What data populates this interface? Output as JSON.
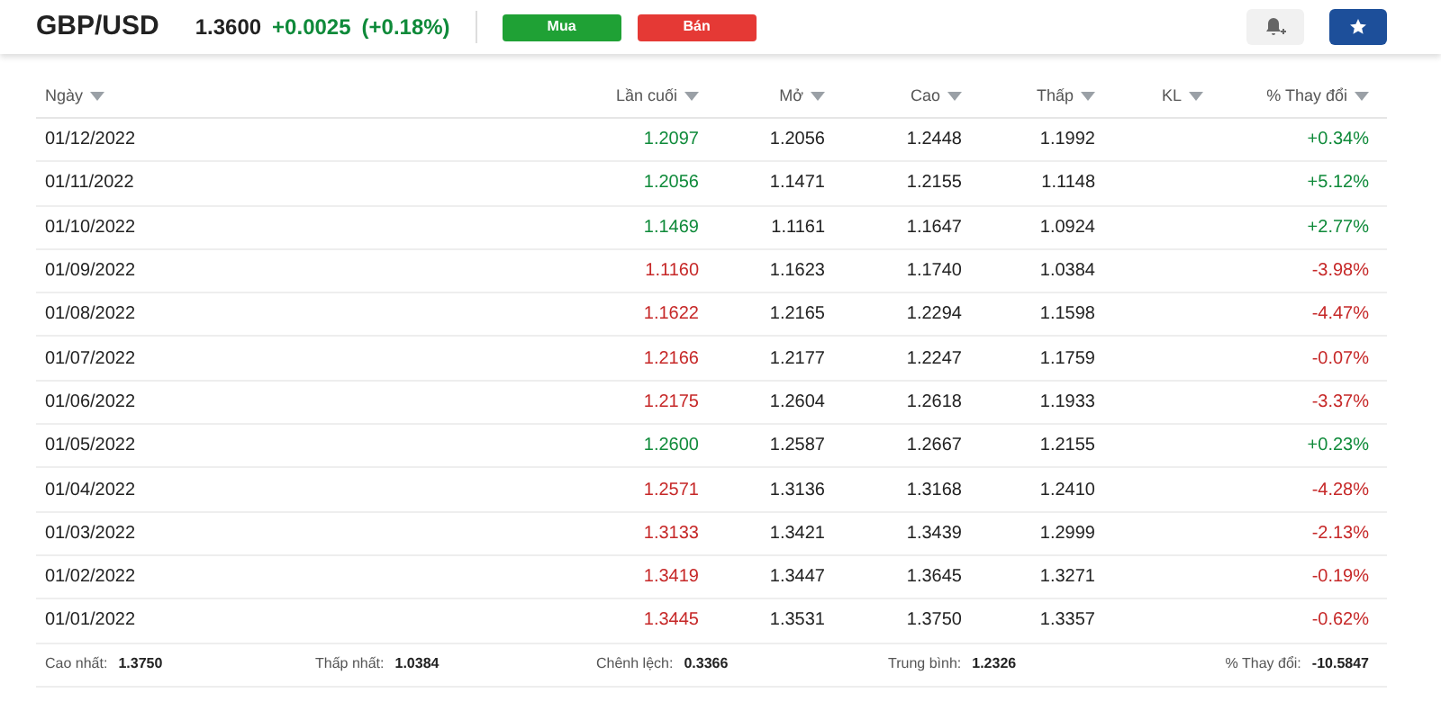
{
  "quote": {
    "symbol": "GBP/USD",
    "price": "1.3600",
    "change": "+0.0025",
    "change_pct": "(+0.18%)"
  },
  "actions": [
    {
      "label": "Mua",
      "kind": "buy"
    },
    {
      "label": "Bán",
      "kind": "sell"
    }
  ],
  "table": {
    "columns": [
      "Ngày",
      "Lần cuối",
      "Mở",
      "Cao",
      "Thấp",
      "KL",
      "% Thay đổi"
    ],
    "rows": [
      {
        "date": "01/12/2022",
        "last": "1.2097",
        "open": "1.2056",
        "high": "1.2448",
        "low": "1.1992",
        "change": "+0.34%",
        "kind": "up"
      },
      {
        "date": "01/11/2022",
        "last": "1.2056",
        "open": "1.1471",
        "high": "1.2155",
        "low": "1.1148",
        "change": "+5.12%",
        "kind": "up"
      },
      {
        "date": "01/10/2022",
        "last": "1.1469",
        "open": "1.1161",
        "high": "1.1647",
        "low": "1.0924",
        "change": "+2.77%",
        "kind": "up"
      },
      {
        "date": "01/09/2022",
        "last": "1.1160",
        "open": "1.1623",
        "high": "1.1740",
        "low": "1.0384",
        "change": "-3.98%",
        "kind": "down"
      },
      {
        "date": "01/08/2022",
        "last": "1.1622",
        "open": "1.2165",
        "high": "1.2294",
        "low": "1.1598",
        "change": "-4.47%",
        "kind": "down"
      },
      {
        "date": "01/07/2022",
        "last": "1.2166",
        "open": "1.2177",
        "high": "1.2247",
        "low": "1.1759",
        "change": "-0.07%",
        "kind": "down"
      },
      {
        "date": "01/06/2022",
        "last": "1.2175",
        "open": "1.2604",
        "high": "1.2618",
        "low": "1.1933",
        "change": "-3.37%",
        "kind": "down"
      },
      {
        "date": "01/05/2022",
        "last": "1.2600",
        "open": "1.2587",
        "high": "1.2667",
        "low": "1.2155",
        "change": "+0.23%",
        "kind": "up"
      },
      {
        "date": "01/04/2022",
        "last": "1.2571",
        "open": "1.3136",
        "high": "1.3168",
        "low": "1.2410",
        "change": "-4.28%",
        "kind": "down"
      },
      {
        "date": "01/03/2022",
        "last": "1.3133",
        "open": "1.3421",
        "high": "1.3439",
        "low": "1.2999",
        "change": "-2.13%",
        "kind": "down"
      },
      {
        "date": "01/02/2022",
        "last": "1.3419",
        "open": "1.3447",
        "high": "1.3645",
        "low": "1.3271",
        "change": "-0.19%",
        "kind": "down"
      },
      {
        "date": "01/01/2022",
        "last": "1.3445",
        "open": "1.3531",
        "high": "1.3750",
        "low": "1.3357",
        "change": "-0.62%",
        "kind": "down"
      }
    ]
  },
  "summary": [
    {
      "label": "Cao nhất:",
      "value": "1.3750"
    },
    {
      "label": "Thấp nhất:",
      "value": "1.0384"
    },
    {
      "label": "Chênh lệch:",
      "value": "0.3366"
    },
    {
      "label": "Trung bình:",
      "value": "1.2326"
    },
    {
      "label": "% Thay đổi:",
      "value": "-10.5847"
    }
  ]
}
